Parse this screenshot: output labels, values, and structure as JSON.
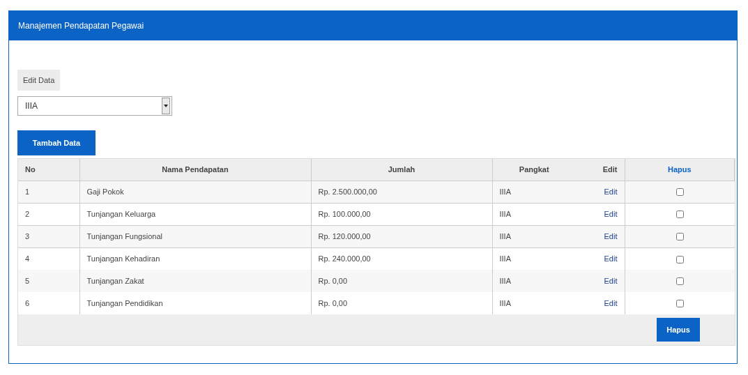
{
  "panel": {
    "title": "Manajemen Pendapatan Pegawai"
  },
  "edit_button": "Edit Data",
  "select": {
    "value": "IIIA"
  },
  "add_button": "Tambah Data",
  "table": {
    "columns": [
      "No",
      "Nama Pendapatan",
      "Jumlah",
      "Pangkat",
      "Edit",
      "Hapus"
    ],
    "rows": [
      {
        "no": "1",
        "name": "Gaji Pokok",
        "amount": "Rp. 2.500.000,00",
        "rank": "IIIA",
        "edit": "Edit",
        "checked": false
      },
      {
        "no": "2",
        "name": "Tunjangan Keluarga",
        "amount": "Rp. 100.000,00",
        "rank": "IIIA",
        "edit": "Edit",
        "checked": false
      },
      {
        "no": "3",
        "name": "Tunjangan Fungsional",
        "amount": "Rp. 120.000,00",
        "rank": "IIIA",
        "edit": "Edit",
        "checked": false
      },
      {
        "no": "4",
        "name": "Tunjangan Kehadiran",
        "amount": "Rp. 240.000,00",
        "rank": "IIIA",
        "edit": "Edit",
        "checked": false
      },
      {
        "no": "5",
        "name": "Tunjangan Zakat",
        "amount": "Rp. 0,00",
        "rank": "IIIA",
        "edit": "Edit",
        "checked": false
      },
      {
        "no": "6",
        "name": "Tunjangan Pendidikan",
        "amount": "Rp. 0,00",
        "rank": "IIIA",
        "edit": "Edit",
        "checked": false
      }
    ]
  },
  "delete_button": "Hapus"
}
